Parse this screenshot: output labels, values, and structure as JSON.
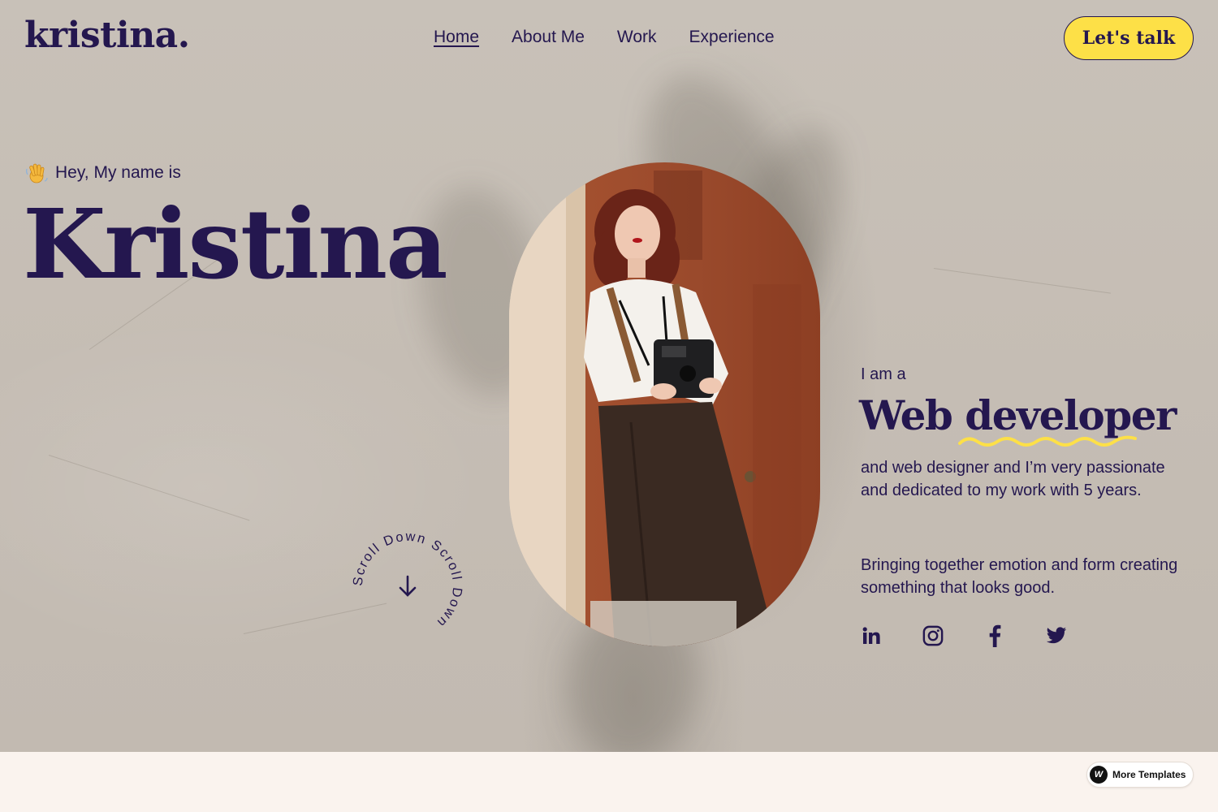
{
  "header": {
    "logo": "kristina.",
    "nav": [
      {
        "label": "Home",
        "active": true
      },
      {
        "label": "About Me",
        "active": false
      },
      {
        "label": "Work",
        "active": false
      },
      {
        "label": "Experience",
        "active": false
      }
    ],
    "cta_label": "Let's talk"
  },
  "hero": {
    "greeting_icon": "waving-hand-emoji",
    "greeting": "Hey, My name is",
    "name": "Kristina",
    "scroll_text": "Scroll Down Scroll Down ",
    "scroll_icon": "arrow-down-icon",
    "photo_icon": "portrait-photo",
    "intro": "I am a",
    "role_word1": "Web",
    "role_word2": "developer",
    "description": "and web designer and I’m very passionate and dedicated to my work with 5 years.",
    "tagline": "Bringing together emotion and form creating something that looks good."
  },
  "socials": [
    {
      "icon": "linkedin-icon"
    },
    {
      "icon": "instagram-icon"
    },
    {
      "icon": "facebook-icon"
    },
    {
      "icon": "twitter-icon"
    }
  ],
  "footer_badge": {
    "icon": "webflow-icon",
    "label": "More Templates"
  },
  "colors": {
    "primary": "#24174f",
    "accent": "#fde047",
    "background": "#c5bdb4",
    "footer": "#faf3ee"
  }
}
